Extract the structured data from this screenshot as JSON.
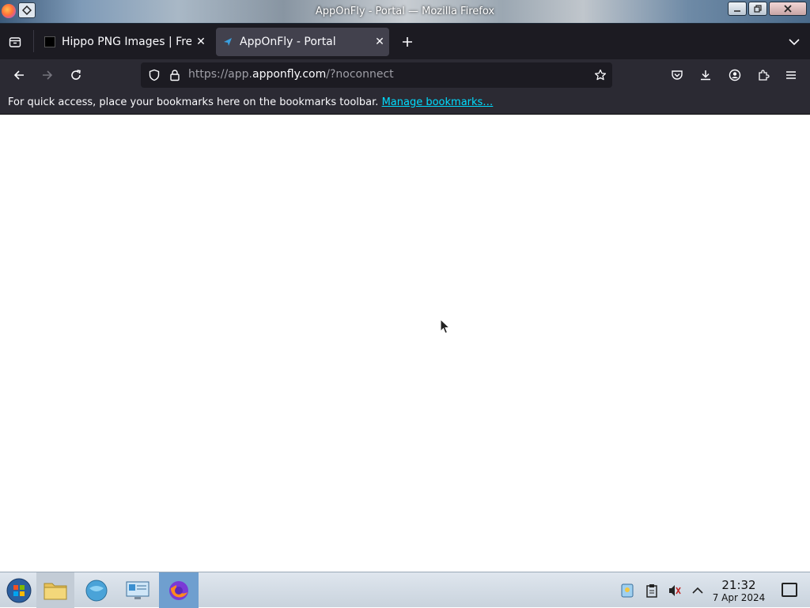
{
  "window": {
    "title": "AppOnFly - Portal — Mozilla Firefox"
  },
  "tabs": [
    {
      "label": "Hippo PNG Images | Free",
      "active": false,
      "favicon": "black-square-icon"
    },
    {
      "label": "AppOnFly - Portal",
      "active": true,
      "favicon": "appOnFly-arrow-icon"
    }
  ],
  "urlbar": {
    "prefix": "https://app.",
    "host": "apponfly.com",
    "path": "/?noconnect"
  },
  "bookmarks_bar": {
    "message": "For quick access, place your bookmarks here on the bookmarks toolbar.",
    "link": "Manage bookmarks…"
  },
  "taskbar": {
    "clock_time": "21:32",
    "clock_date": "7 Apr 2024"
  },
  "colors": {
    "tab_bar": "#1c1b22",
    "toolbar": "#2b2a33",
    "active_tab": "#42414d",
    "link": "#00ddff",
    "taskbar": "#dfe6ee"
  }
}
